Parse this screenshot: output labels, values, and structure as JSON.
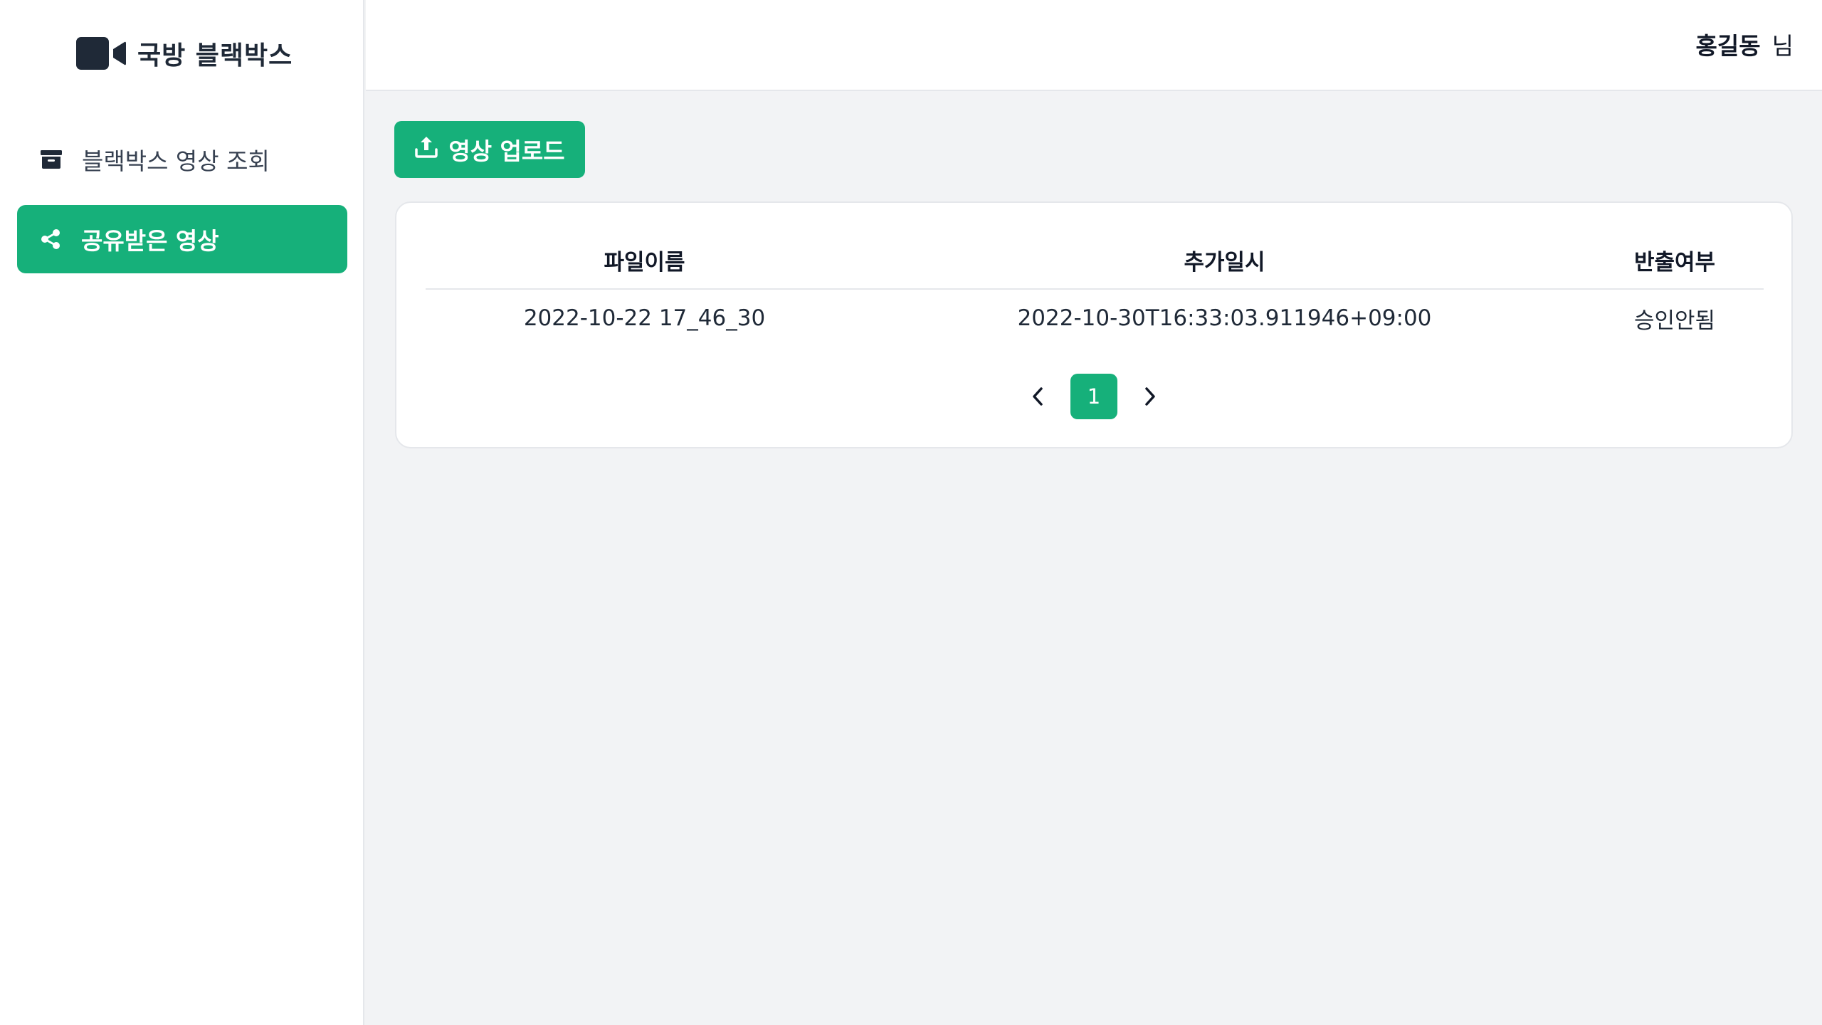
{
  "brand": {
    "name": "국방 블랙박스",
    "logo_icon": "video-camera-icon"
  },
  "sidebar": {
    "items": [
      {
        "label": "블랙박스 영상 조회",
        "icon": "archive-box-icon",
        "active": false
      },
      {
        "label": "공유받은 영상",
        "icon": "share-icon",
        "active": true
      }
    ]
  },
  "header": {
    "user_name": "홍길동",
    "user_suffix": "님"
  },
  "toolbar": {
    "upload_label": "영상 업로드",
    "upload_icon": "upload-icon"
  },
  "table": {
    "columns": [
      "파일이름",
      "추가일시",
      "반출여부"
    ],
    "rows": [
      [
        "2022-10-22 17_46_30",
        "2022-10-30T16:33:03.911946+09:00",
        "승인안됨"
      ]
    ]
  },
  "pagination": {
    "current_page": "1",
    "prev_icon": "chevron-left-icon",
    "next_icon": "chevron-right-icon"
  },
  "colors": {
    "accent": "#16b07a",
    "sidebar_bg": "#ffffff",
    "content_bg": "#f2f3f5",
    "logo_dark": "#1f2937"
  }
}
